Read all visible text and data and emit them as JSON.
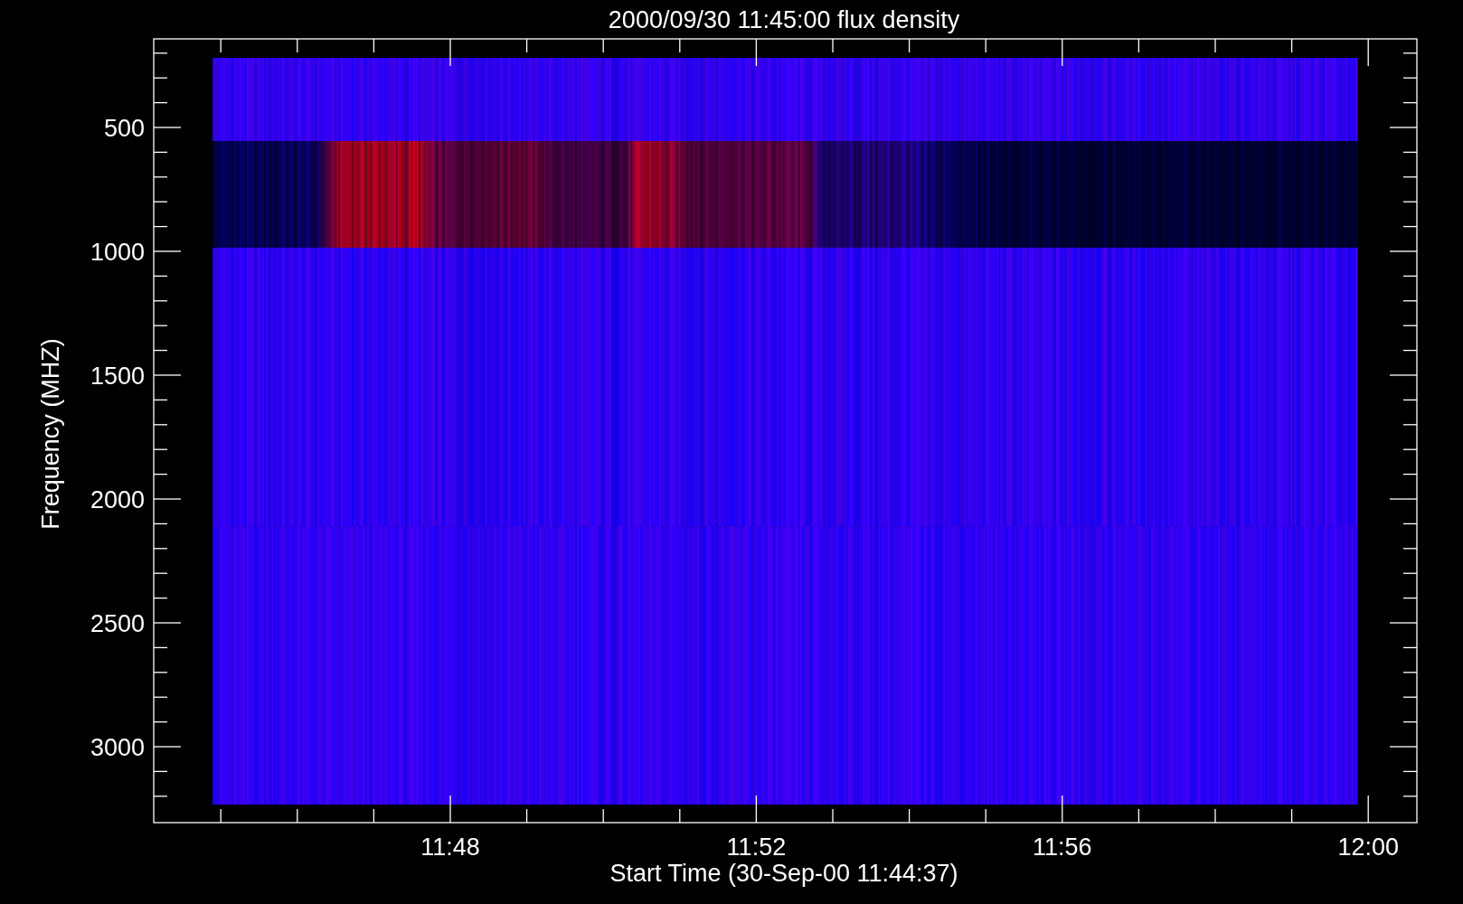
{
  "title": "2000/09/30 11:45:00 flux density",
  "y_axis": {
    "label": "Frequency (MHZ)",
    "ticks": [
      "500",
      "1000",
      "1500",
      "2000",
      "2500",
      "3000"
    ]
  },
  "x_axis": {
    "label": "Start Time (30-Sep-00 11:44:37)",
    "ticks": [
      "11:48",
      "11:52",
      "11:56",
      "12:00"
    ]
  }
}
